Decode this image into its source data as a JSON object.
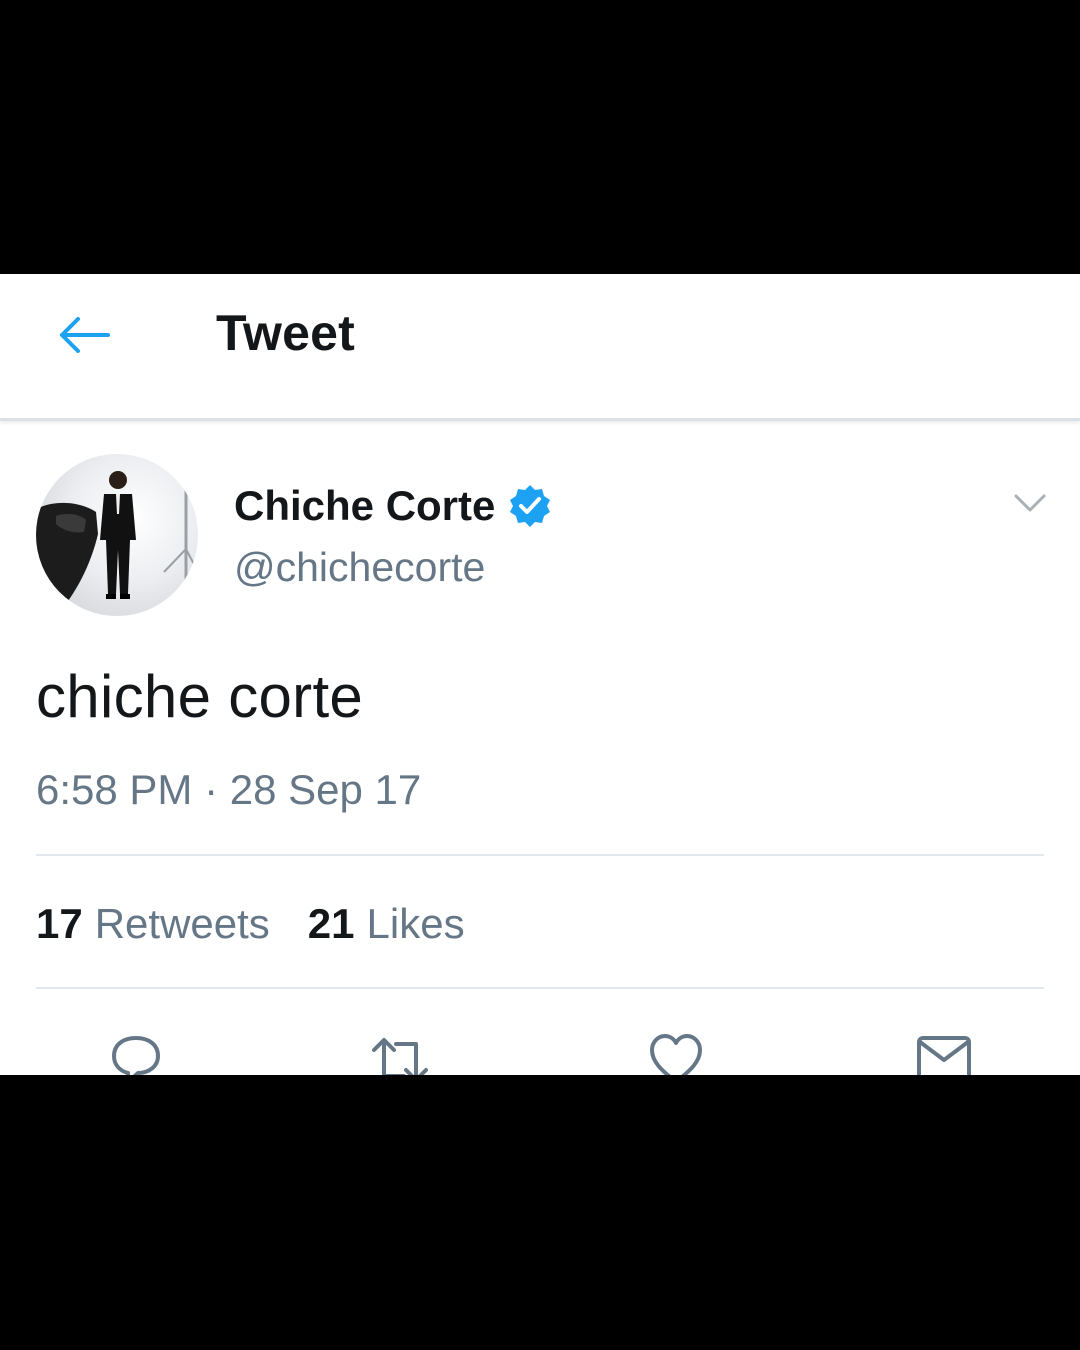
{
  "header": {
    "back_icon": "arrow-left-icon",
    "title": "Tweet"
  },
  "tweet": {
    "author": {
      "display_name": "Chiche Corte",
      "handle": "@chichecorte",
      "verified_icon": "verified-badge-icon"
    },
    "more_icon": "chevron-down-icon",
    "text": "chiche corte",
    "timestamp": "6:58 PM · 28 Sep 17",
    "stats": {
      "retweets_count": "17",
      "retweets_label": "Retweets",
      "likes_count": "21",
      "likes_label": "Likes"
    },
    "actions": [
      "reply-icon",
      "retweet-icon",
      "like-icon",
      "direct-message-icon"
    ]
  },
  "colors": {
    "accent": "#1da1f2",
    "text_primary": "#14171a",
    "text_secondary": "#657786",
    "divider": "#e1e8ed",
    "frame": "#000000"
  }
}
